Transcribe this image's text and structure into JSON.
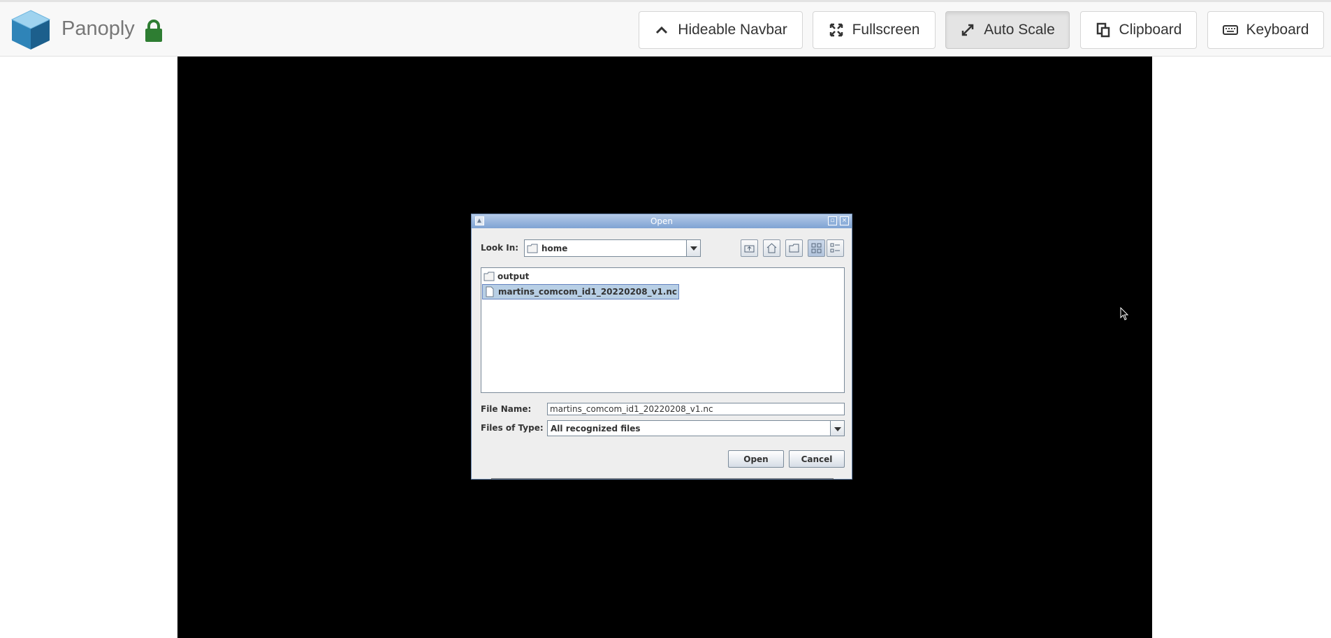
{
  "navbar": {
    "brand": "Panoply",
    "buttons": {
      "hideable_navbar": "Hideable Navbar",
      "fullscreen": "Fullscreen",
      "auto_scale": "Auto Scale",
      "clipboard": "Clipboard",
      "keyboard": "Keyboard"
    }
  },
  "dialog": {
    "title": "Open",
    "look_in_label": "Look In:",
    "look_in_value": "home",
    "files": [
      {
        "name": "output",
        "type": "folder"
      },
      {
        "name": "martins_comcom_id1_20220208_v1.nc",
        "type": "file",
        "selected": true
      }
    ],
    "file_name_label": "File Name:",
    "file_name_value": "martins_comcom_id1_20220208_v1.nc",
    "files_of_type_label": "Files of Type:",
    "files_of_type_value": "All recognized files",
    "open_button": "Open",
    "cancel_button": "Cancel"
  }
}
